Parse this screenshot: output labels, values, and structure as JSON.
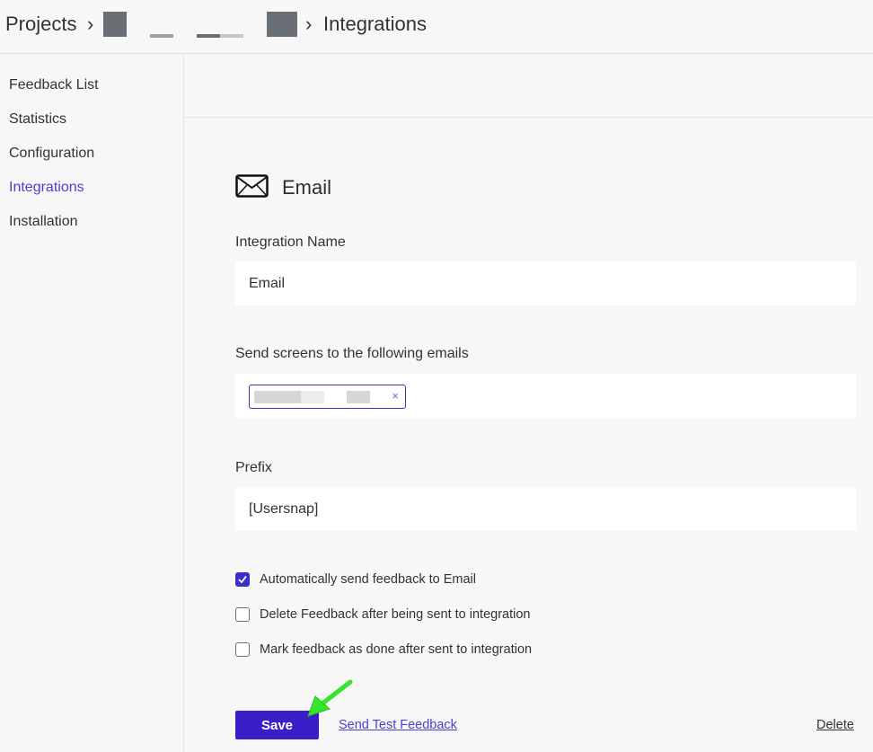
{
  "header": {
    "crumb_projects": "Projects",
    "sep": "›",
    "crumb_current": "Integrations"
  },
  "sidebar": {
    "items": [
      {
        "label": "Feedback List",
        "active": false
      },
      {
        "label": "Statistics",
        "active": false
      },
      {
        "label": "Configuration",
        "active": false
      },
      {
        "label": "Integrations",
        "active": true
      },
      {
        "label": "Installation",
        "active": false
      }
    ]
  },
  "integration": {
    "icon": "envelope-icon",
    "title": "Email",
    "name_label": "Integration Name",
    "name_value": "Email",
    "emails_label": "Send screens to the following emails",
    "chip_remove": "×",
    "prefix_label": "Prefix",
    "prefix_value": "[Usersnap]"
  },
  "options": [
    {
      "label": "Automatically send feedback to Email",
      "checked": true
    },
    {
      "label": "Delete Feedback after being sent to integration",
      "checked": false
    },
    {
      "label": "Mark feedback as done after sent to integration",
      "checked": false
    }
  ],
  "actions": {
    "save": "Save",
    "test": "Send Test Feedback",
    "delete": "Delete"
  },
  "colors": {
    "accent": "#3a1fc8",
    "link": "#4a3fd4",
    "annotation_arrow": "#35e52a"
  }
}
